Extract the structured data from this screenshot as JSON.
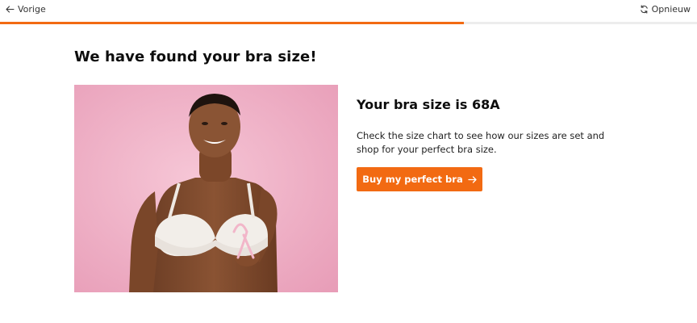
{
  "nav": {
    "back_label": "Vorige",
    "back_icon": "arrow-left-icon",
    "restart_label": "Opnieuw",
    "restart_icon": "refresh-icon"
  },
  "progress": {
    "fraction": 0.666
  },
  "page": {
    "title": "We have found your bra size!"
  },
  "result": {
    "title": "Your bra size is 68A",
    "description": "Check the size chart to see how our sizes are set and shop for your perfect bra size.",
    "cta_label": "Buy my perfect bra",
    "cta_icon": "arrow-right-icon"
  },
  "colors": {
    "accent": "#f26a12",
    "photo_background": "#efb3c8"
  }
}
